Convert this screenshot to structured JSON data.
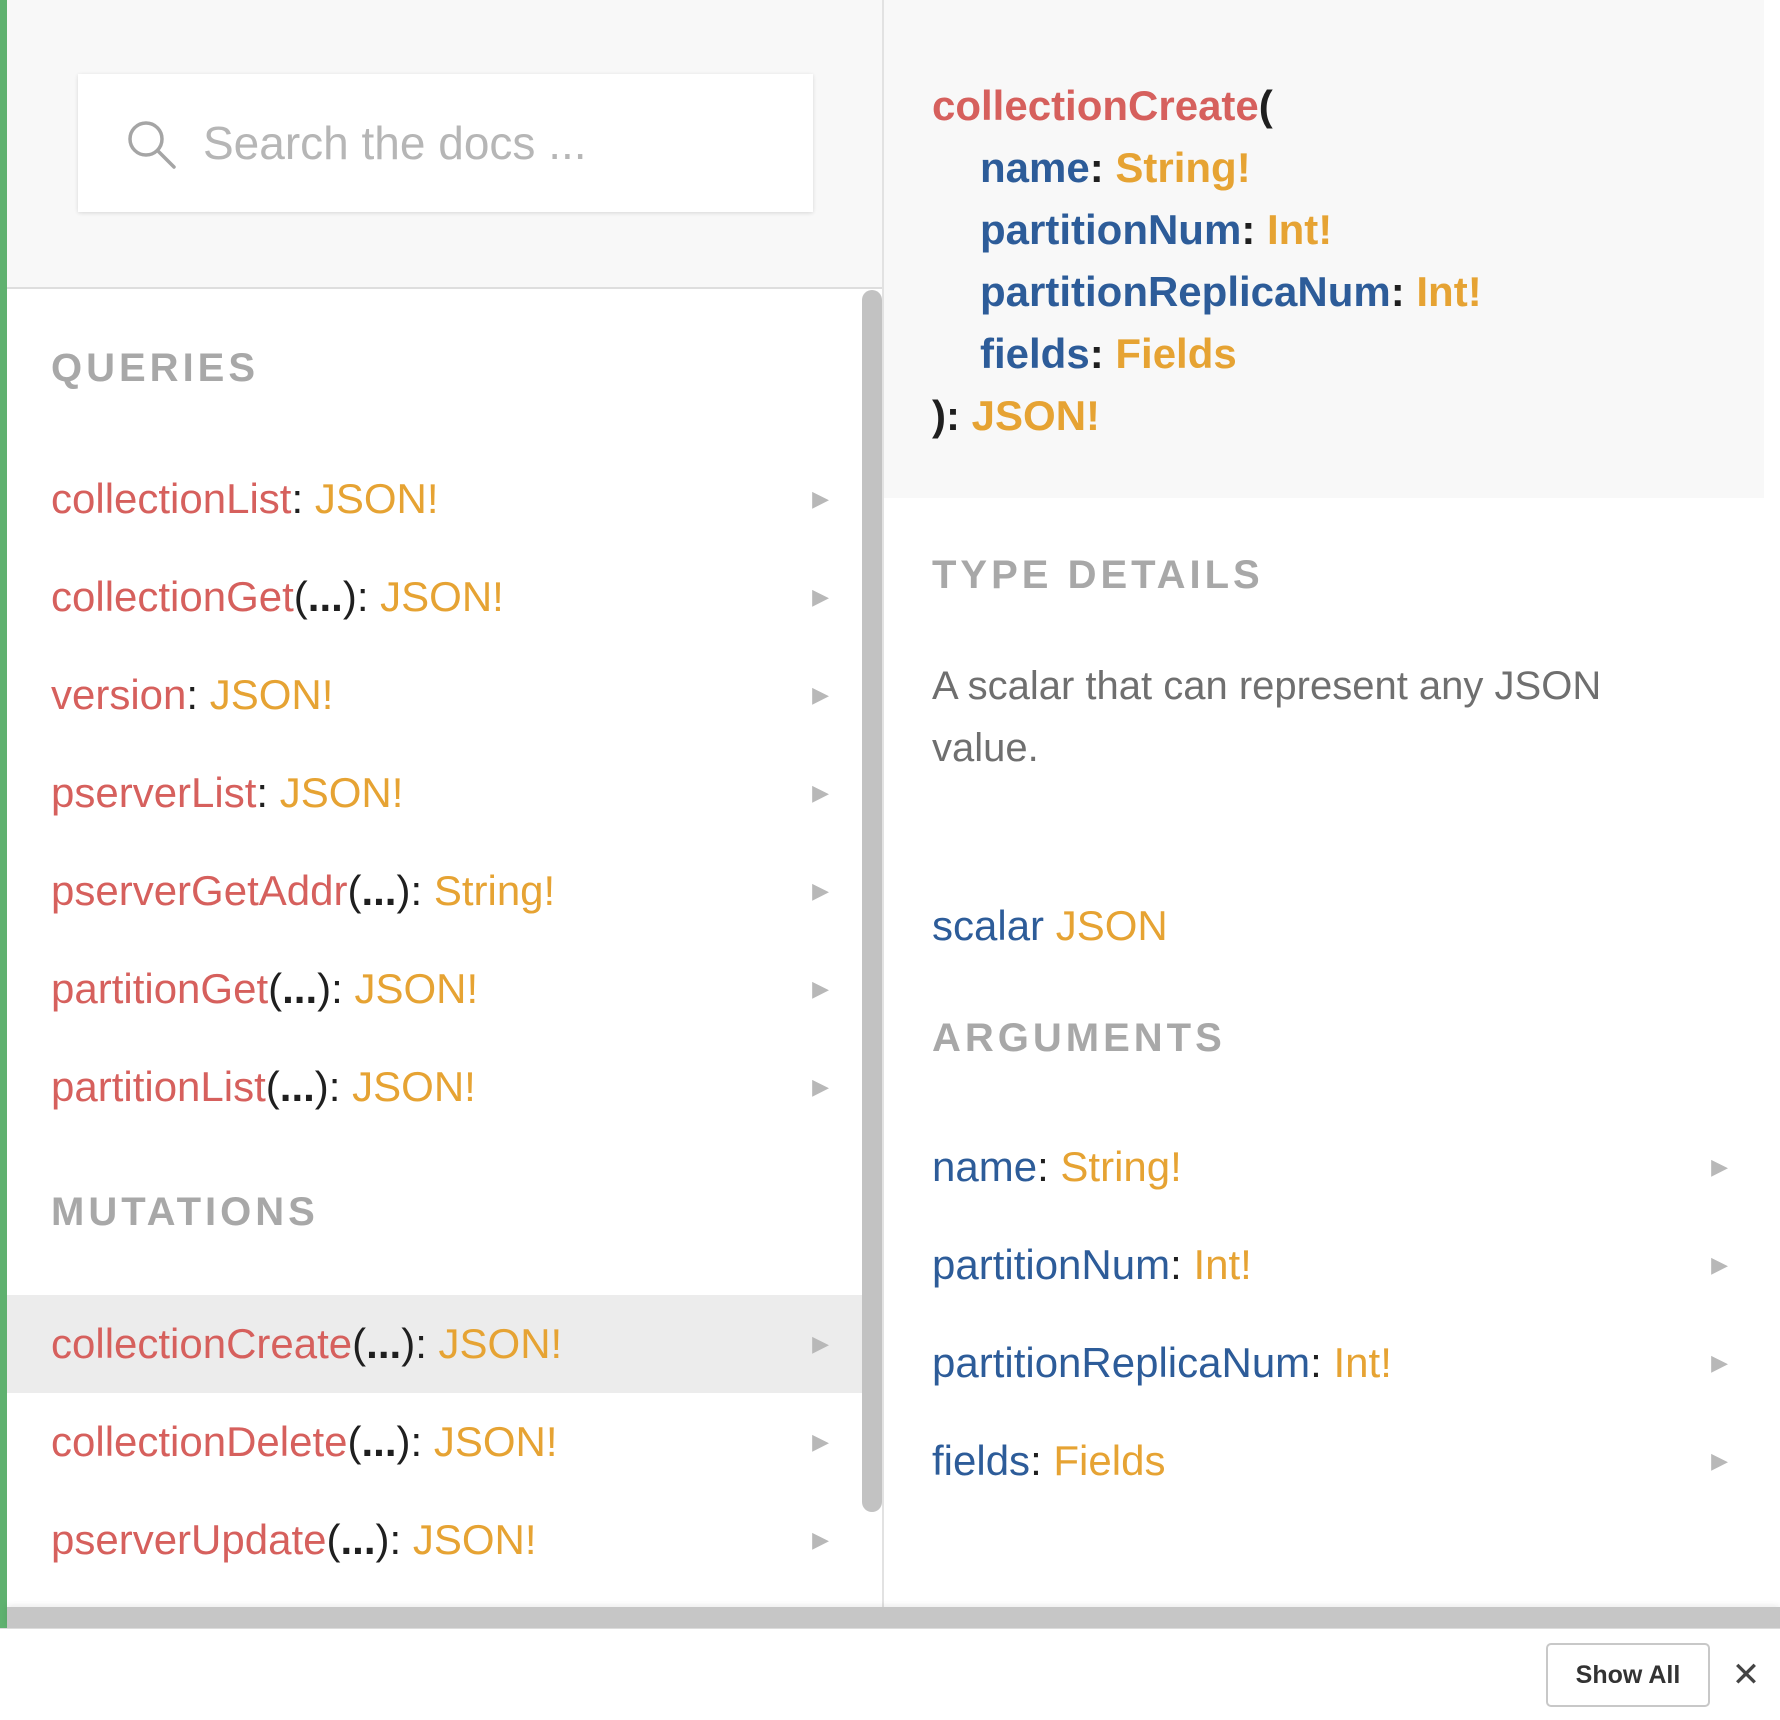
{
  "search": {
    "placeholder": "Search the docs ..."
  },
  "queries": {
    "heading": "QUERIES",
    "items": [
      {
        "name": "collectionList",
        "args": "",
        "type": "JSON!"
      },
      {
        "name": "collectionGet",
        "args": "...",
        "type": "JSON!"
      },
      {
        "name": "version",
        "args": "",
        "type": "JSON!"
      },
      {
        "name": "pserverList",
        "args": "",
        "type": "JSON!"
      },
      {
        "name": "pserverGetAddr",
        "args": "...",
        "type": "String!"
      },
      {
        "name": "partitionGet",
        "args": "...",
        "type": "JSON!"
      },
      {
        "name": "partitionList",
        "args": "...",
        "type": "JSON!"
      }
    ]
  },
  "mutations": {
    "heading": "MUTATIONS",
    "items": [
      {
        "name": "collectionCreate",
        "args": "...",
        "type": "JSON!",
        "selected": true
      },
      {
        "name": "collectionDelete",
        "args": "...",
        "type": "JSON!"
      },
      {
        "name": "pserverUpdate",
        "args": "...",
        "type": "JSON!"
      }
    ]
  },
  "signature": {
    "name": "collectionCreate",
    "open": "(",
    "args": [
      {
        "name": "name",
        "type": "String!"
      },
      {
        "name": "partitionNum",
        "type": "Int!"
      },
      {
        "name": "partitionReplicaNum",
        "type": "Int!"
      },
      {
        "name": "fields",
        "type": "Fields"
      }
    ],
    "close": "):",
    "return_type": "JSON!"
  },
  "type_details": {
    "heading": "TYPE DETAILS",
    "description": "A scalar that can represent any JSON value.",
    "scalar_keyword": "scalar",
    "scalar_name": "JSON"
  },
  "arguments": {
    "heading": "ARGUMENTS",
    "items": [
      {
        "name": "name",
        "type": "String!"
      },
      {
        "name": "partitionNum",
        "type": "Int!"
      },
      {
        "name": "partitionReplicaNum",
        "type": "Int!"
      },
      {
        "name": "fields",
        "type": "Fields"
      }
    ]
  },
  "footer": {
    "show_all_label": "Show All",
    "close_glyph": "✕"
  },
  "glyphs": {
    "arrow": "▶",
    "colon": ":",
    "paren_open": "(",
    "paren_close": ")"
  },
  "colors": {
    "field_name": "#d6605d",
    "type_name": "#e6a333",
    "arg_name": "#2d5c99",
    "accent_bar": "#5fb16f",
    "selected_row": "#ececec"
  }
}
